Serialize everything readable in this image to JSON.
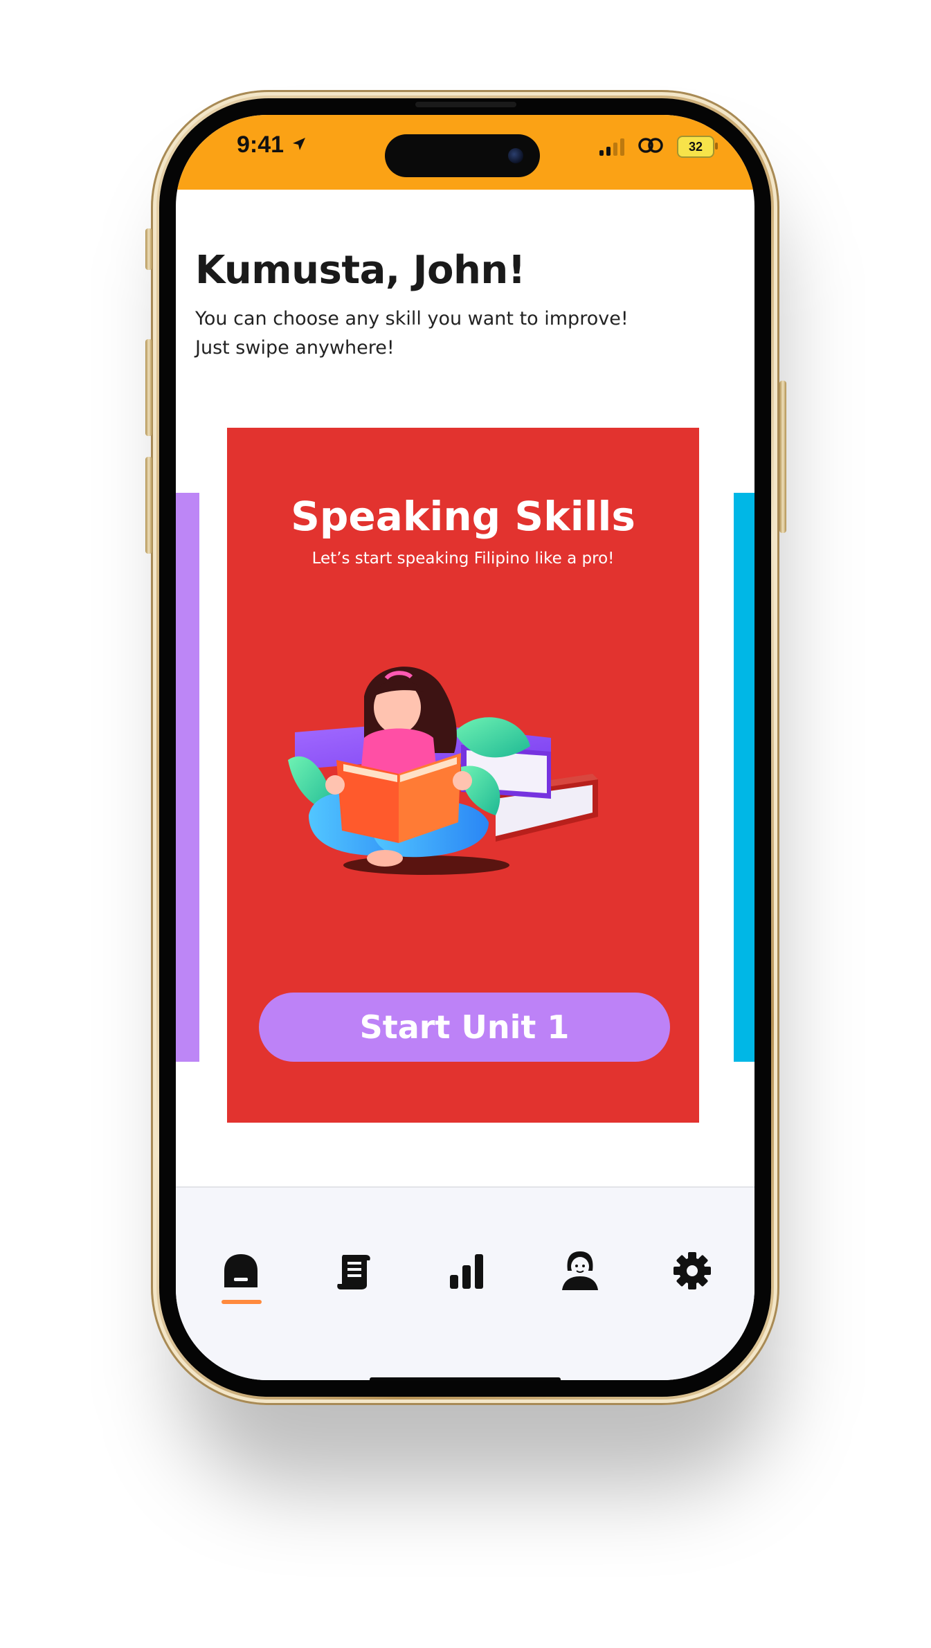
{
  "status_bar": {
    "time": "9:41",
    "battery": "32",
    "background_color": "#fba215"
  },
  "header": {
    "greeting": "Kumusta, John!",
    "subtitle_line1": "You can choose any skill you want to improve!",
    "subtitle_line2": "Just swipe anywhere!"
  },
  "carousel": {
    "active_card": {
      "title": "Speaking Skills",
      "subtitle": "Let’s start speaking Filipino like a pro!",
      "illustration": "girl-reading-books-illustration",
      "button_label": "Start Unit 1",
      "card_color": "#e2332f",
      "button_color": "#bd82f7"
    },
    "left_card_color": "#bd86f6",
    "right_card_color": "#00b7e6"
  },
  "bottom_nav": {
    "active": "home",
    "indicator_color": "#ff8a3d",
    "items": [
      {
        "id": "home",
        "icon": "home-icon"
      },
      {
        "id": "lessons",
        "icon": "scroll-icon"
      },
      {
        "id": "progress",
        "icon": "bar-chart-icon"
      },
      {
        "id": "profile",
        "icon": "user-avatar-icon"
      },
      {
        "id": "settings",
        "icon": "gear-icon"
      }
    ]
  }
}
